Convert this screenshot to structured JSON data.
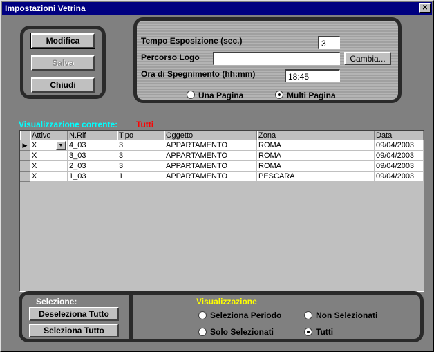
{
  "window": {
    "title": "Impostazioni Vetrina",
    "close_glyph": "✕"
  },
  "actions": {
    "modifica": "Modifica",
    "salva": "Salva",
    "chiudi": "Chiudi"
  },
  "settings": {
    "tempo_label": "Tempo Esposizione (sec.)",
    "tempo_value": "3",
    "percorso_label": "Percorso Logo",
    "percorso_value": "",
    "cambia_label": "Cambia...",
    "ora_label": "Ora di Spegnimento (hh:mm)",
    "ora_value": "18:45",
    "una_pagina": "Una Pagina",
    "multi_pagina": "Multi Pagina",
    "selected_layout": "Multi Pagina"
  },
  "current": {
    "label": "Visualizzazione corrente:",
    "value": "Tutti"
  },
  "grid": {
    "columns": [
      "Attivo",
      "N.Rif",
      "Tipo",
      "Oggetto",
      "Zona",
      "Data"
    ],
    "rows": [
      {
        "attivo": "X",
        "nrif": "4_03",
        "tipo": "3",
        "oggetto": "APPARTAMENTO",
        "zona": "ROMA",
        "data": "09/04/2003"
      },
      {
        "attivo": "X",
        "nrif": "3_03",
        "tipo": "3",
        "oggetto": "APPARTAMENTO",
        "zona": "ROMA",
        "data": "09/04/2003"
      },
      {
        "attivo": "X",
        "nrif": "2_03",
        "tipo": "3",
        "oggetto": "APPARTAMENTO",
        "zona": "ROMA",
        "data": "09/04/2003"
      },
      {
        "attivo": "X",
        "nrif": "1_03",
        "tipo": "1",
        "oggetto": "APPARTAMENTO",
        "zona": "PESCARA",
        "data": "09/04/2003"
      }
    ]
  },
  "selezione": {
    "label": "Selezione:",
    "deseleziona": "Deseleziona Tutto",
    "seleziona": "Seleziona Tutto"
  },
  "visualizzazione": {
    "title": "Visualizzazione",
    "seleziona_periodo": "Seleziona Periodo",
    "non_selezionati": "Non Selezionati",
    "solo_selezionati": "Solo Selezionati",
    "tutti": "Tutti",
    "selected": "Tutti"
  },
  "colors": {
    "title_bar": "#000080",
    "current_label": "#00ffff",
    "current_value": "#ff0000",
    "visualizzazione_title": "#ffff00"
  }
}
